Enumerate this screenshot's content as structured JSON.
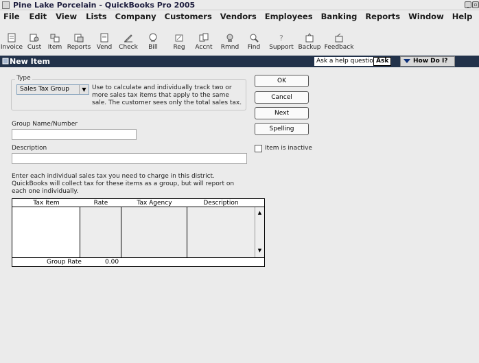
{
  "window": {
    "title": "Pine Lake Porcelain - QuickBooks Pro 2005"
  },
  "menu": [
    "File",
    "Edit",
    "View",
    "Lists",
    "Company",
    "Customers",
    "Vendors",
    "Employees",
    "Banking",
    "Reports",
    "Window",
    "Help"
  ],
  "toolbar": [
    {
      "label": "Invoice",
      "icon": "invoice-icon"
    },
    {
      "label": "Cust",
      "icon": "customer-icon"
    },
    {
      "label": "Item",
      "icon": "item-icon"
    },
    {
      "label": "Reports",
      "icon": "reports-icon"
    },
    {
      "label": "Vend",
      "icon": "vendor-icon"
    },
    {
      "label": "Check",
      "icon": "check-icon"
    },
    {
      "label": "Bill",
      "icon": "bill-icon"
    },
    {
      "label": "Reg",
      "icon": "register-icon"
    },
    {
      "label": "Accnt",
      "icon": "accounts-icon"
    },
    {
      "label": "Rmnd",
      "icon": "reminders-icon"
    },
    {
      "label": "Find",
      "icon": "find-icon"
    },
    {
      "label": "Support",
      "icon": "support-icon"
    },
    {
      "label": "Backup",
      "icon": "backup-icon"
    },
    {
      "label": "Feedback",
      "icon": "feedback-icon"
    }
  ],
  "header": {
    "title": "New Item",
    "help_prompt": "Ask a help question",
    "ask_label": "Ask",
    "how_do_i": "How Do I?"
  },
  "form": {
    "type_legend": "Type",
    "type_value": "Sales Tax Group",
    "type_description": "Use to calculate and individually track two or more sales tax items that apply to the same sale. The customer sees only the total sales tax.",
    "group_name_label": "Group Name/Number",
    "group_name_value": "",
    "description_label": "Description",
    "description_value": "",
    "instructions": "Enter each individual sales tax you need to charge in this district.  QuickBooks will collect tax for these items as a group, but will report on each one individually.",
    "inactive_label": "Item is inactive",
    "inactive_checked": false
  },
  "buttons": {
    "ok": "OK",
    "cancel": "Cancel",
    "next": "Next",
    "spelling": "Spelling"
  },
  "table": {
    "columns": [
      "Tax Item",
      "Rate",
      "Tax Agency",
      "Description"
    ],
    "rows": [],
    "footer_label": "Group Rate",
    "footer_value": "0.00"
  },
  "colors": {
    "header_bg": "#22324a",
    "background": "#ebebeb"
  }
}
